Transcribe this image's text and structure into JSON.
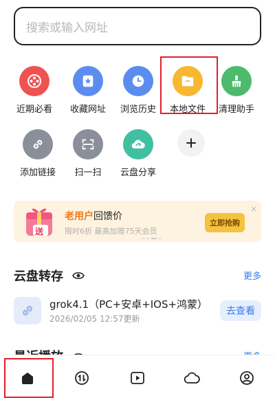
{
  "search": {
    "placeholder": "搜索或输入网址"
  },
  "tools_row1": [
    {
      "label": "近期必看",
      "icon": "film-reel-icon",
      "color": "#ef5350"
    },
    {
      "label": "收藏网址",
      "icon": "bookmark-star-icon",
      "color": "#5b8def"
    },
    {
      "label": "浏览历史",
      "icon": "clock-icon",
      "color": "#5b8def"
    },
    {
      "label": "本地文件",
      "icon": "folder-icon",
      "color": "#f7b731"
    },
    {
      "label": "清理助手",
      "icon": "broom-icon",
      "color": "#4cbb6c"
    }
  ],
  "tools_row2": [
    {
      "label": "添加链接",
      "icon": "link-icon",
      "color": "#8a8f99"
    },
    {
      "label": "扫一扫",
      "icon": "scan-icon",
      "color": "#8a8f99"
    },
    {
      "label": "云盘分享",
      "icon": "cloud-share-icon",
      "color": "#40c0a0"
    },
    {
      "label": "",
      "icon": "plus-icon",
      "color": "#f2f2f2"
    }
  ],
  "banner": {
    "title_highlight": "老用户",
    "title_rest": "回馈价",
    "subtitle": "限时6折  最高加赠75天会员",
    "button": "立即抢购",
    "close": "×",
    "gift_text": "送"
  },
  "cloud_section": {
    "title": "云盘转存",
    "more": "更多"
  },
  "file": {
    "name": "grok4.1（PC+安卓+IOS+鸿蒙）",
    "time": "2026/02/05 12:57更新",
    "action": "去查看"
  },
  "recent_section": {
    "title": "最近播放",
    "more": "更多"
  },
  "tabbar": [
    {
      "icon": "home-icon"
    },
    {
      "icon": "transfer-icon"
    },
    {
      "icon": "video-play-icon"
    },
    {
      "icon": "cloud-icon"
    },
    {
      "icon": "user-icon"
    }
  ],
  "colors": {
    "accent": "#3a7be6",
    "highlight": "#e11f2a",
    "banner_bg": "#fdf3e0"
  }
}
